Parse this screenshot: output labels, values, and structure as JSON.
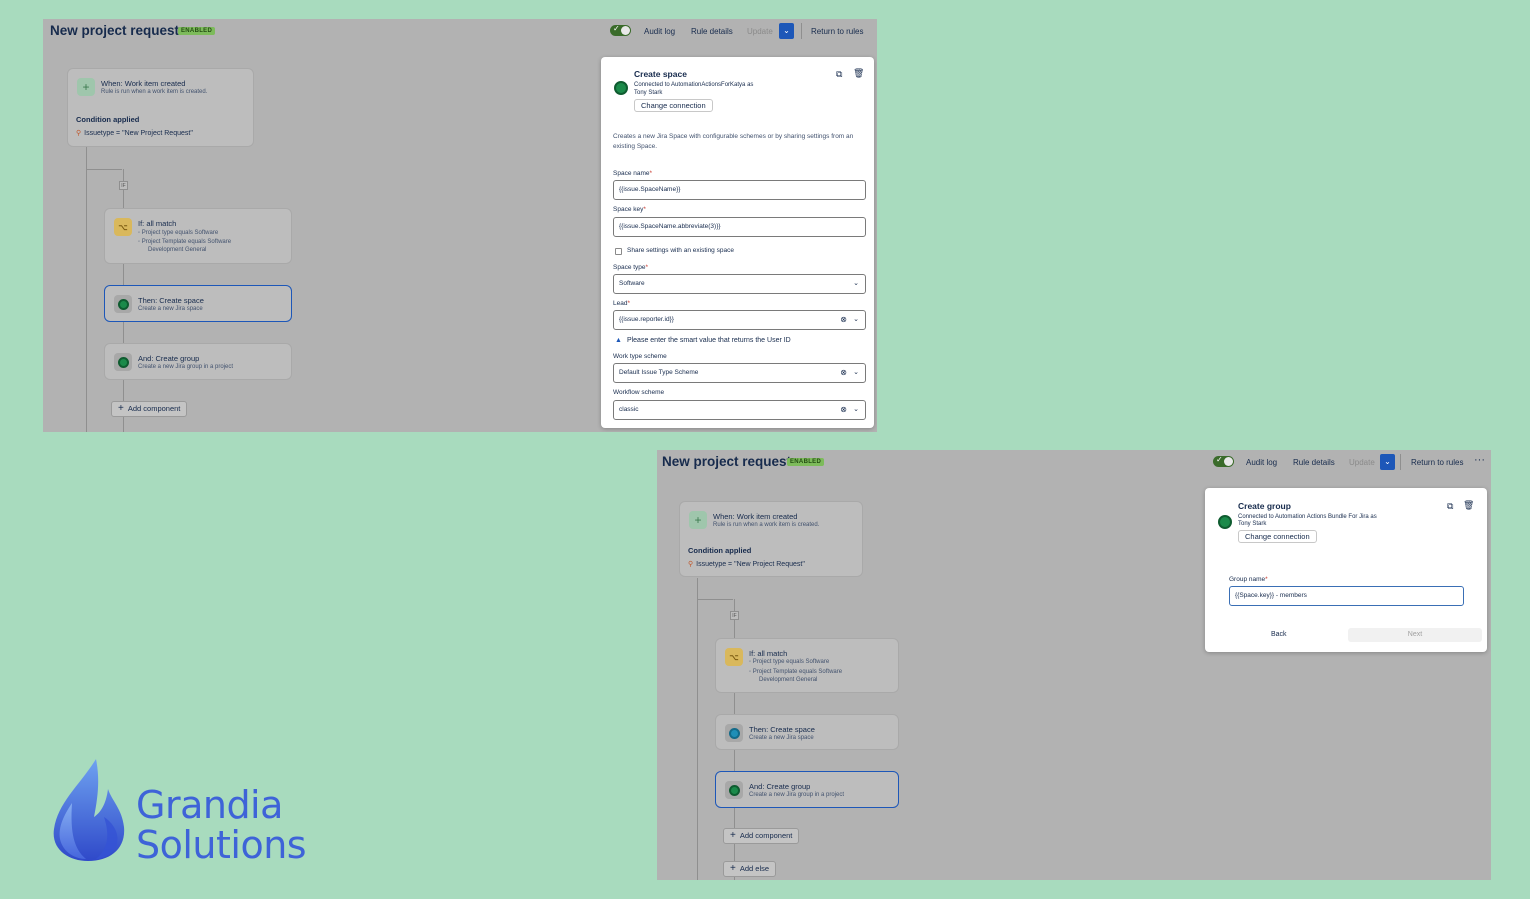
{
  "screen1": {
    "title": "New project request",
    "badge": "ENABLED",
    "topbar": {
      "audit_log": "Audit log",
      "rule_details": "Rule details",
      "update": "Update",
      "return": "Return to rules"
    },
    "trigger": {
      "title": "When: Work item created",
      "subtitle": "Rule is run when a work item is created.",
      "condition_heading": "Condition applied",
      "condition_value": "Issuetype = \"New Project Request\""
    },
    "if_label": "IF",
    "if_node": {
      "title": "If: all match",
      "items": [
        "Project type equals Software",
        "Project Template equals Software",
        "Development General"
      ]
    },
    "then_node": {
      "title": "Then: Create space",
      "subtitle": "Create a new Jira space"
    },
    "and_node": {
      "title": "And: Create group",
      "subtitle": "Create a new Jira group in a project"
    },
    "add_component": "Add component",
    "panel": {
      "title": "Create space",
      "connection_line1": "Connected to AutomationActionsForKatya as",
      "connection_line2": "Tony Stark",
      "change_connection": "Change connection",
      "description": "Creates a new Jira Space with configurable schemes or by sharing settings from an existing Space.",
      "space_name_label": "Space name",
      "space_name_value": "{{issue.SpaceName}}",
      "space_key_label": "Space key",
      "space_key_value": "{{issue.SpaceName.abbreviate(3)}}",
      "share_settings": "Share settings with an existing space",
      "space_type_label": "Space type",
      "space_type_value": "Software",
      "lead_label": "Lead",
      "lead_value": "{{issue.reporter.id}}",
      "lead_hint": "Please enter the smart value that returns the User ID",
      "work_type_label": "Work type scheme",
      "work_type_value": "Default Issue Type Scheme",
      "workflow_label": "Workflow scheme",
      "workflow_value": "classic",
      "required": "*"
    }
  },
  "screen2": {
    "title": "New project request",
    "badge": "ENABLED",
    "topbar": {
      "audit_log": "Audit log",
      "rule_details": "Rule details",
      "update": "Update",
      "return": "Return to rules",
      "more": "···"
    },
    "trigger": {
      "title": "When: Work item created",
      "subtitle": "Rule is run when a work item is created.",
      "condition_heading": "Condition applied",
      "condition_value": "Issuetype = \"New Project Request\""
    },
    "if_label": "IF",
    "if_node": {
      "title": "If: all match",
      "items": [
        "Project type equals Software",
        "Project Template equals Software",
        "Development General"
      ]
    },
    "then_node": {
      "title": "Then: Create space",
      "subtitle": "Create a new Jira space"
    },
    "and_node": {
      "title": "And: Create group",
      "subtitle": "Create a new Jira group in a project"
    },
    "add_component": "Add component",
    "add_else": "Add else",
    "panel": {
      "title": "Create group",
      "connection_line1": "Connected to Automation Actions Bundle For Jira as",
      "connection_line2": "Tony Stark",
      "change_connection": "Change connection",
      "group_name_label": "Group name",
      "group_name_value": "{{Space.key}} - members",
      "back": "Back",
      "next": "Next",
      "required": "*"
    }
  },
  "brand": {
    "line1": "Grandia",
    "line2": "Solutions"
  },
  "colors": {
    "background": "#a8dbbe",
    "accent": "#1d57b8",
    "brand": "#3e63d8",
    "badge": "#7dbb5b"
  },
  "icons": [
    "plus-icon",
    "condition-icon",
    "jira-app-icon",
    "search-icon",
    "copy-icon",
    "trash-icon",
    "clear-icon",
    "chevron-down-icon",
    "warning-icon",
    "check-icon",
    "flame-logo-icon"
  ]
}
